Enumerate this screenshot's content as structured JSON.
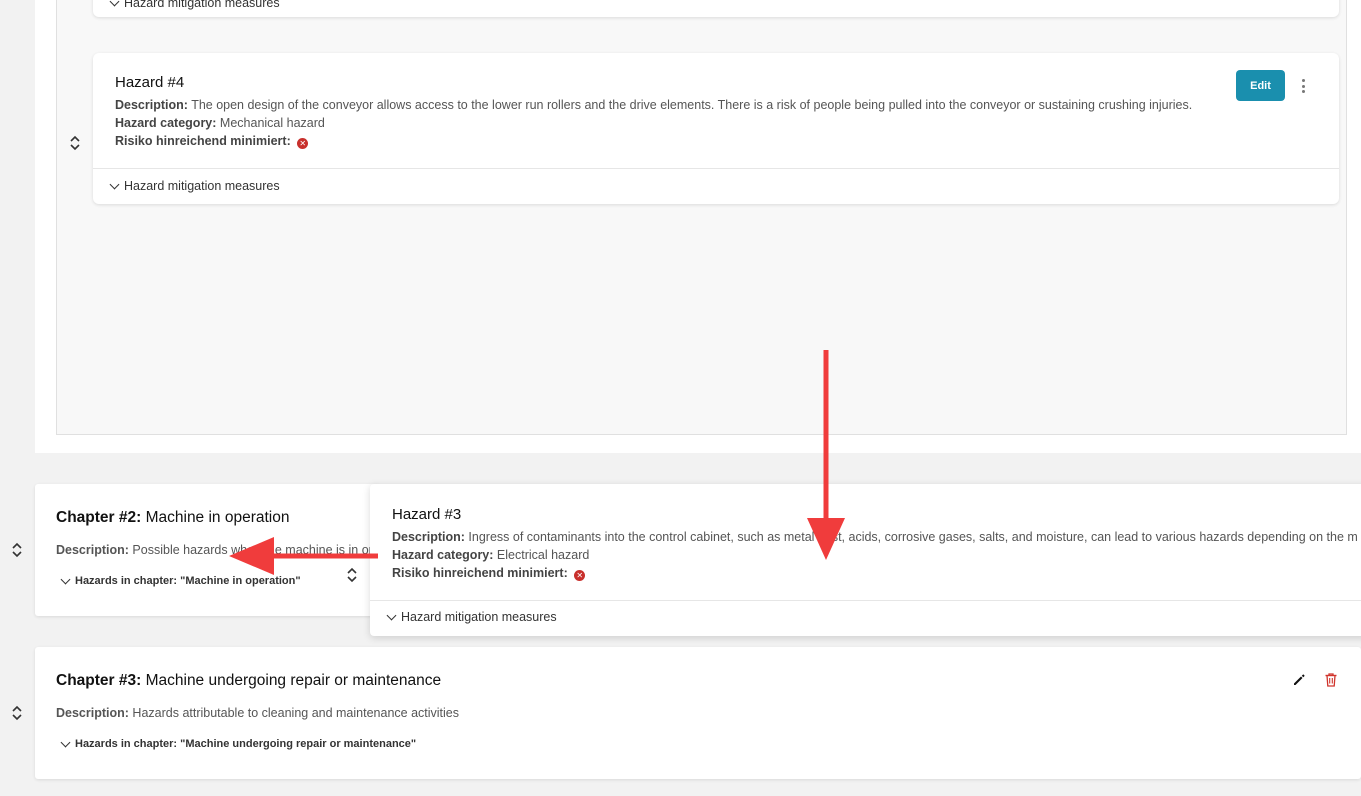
{
  "hazard_prev": {
    "toggle_label": "Hazard mitigation measures"
  },
  "hazard4": {
    "title": "Hazard #4",
    "description_label": "Description:",
    "description": "The open design of the conveyor allows access to the lower run rollers and the drive elements. There is a risk of people being pulled into the conveyor or sustaining crushing injuries.",
    "category_label": "Hazard category:",
    "category": "Mechanical hazard",
    "risk_label": "Risiko hinreichend minimiert:",
    "risk_icon": "x-circle-icon",
    "edit_label": "Edit",
    "toggle_label": "Hazard mitigation measures"
  },
  "chapter2": {
    "title_prefix": "Chapter #2:",
    "title": "Machine in operation",
    "description_label": "Description:",
    "description": "Possible hazards when the machine is in op",
    "toggle_label": "Hazards in chapter: \"Machine in operation\""
  },
  "hazard3": {
    "title": "Hazard #3",
    "description_label": "Description:",
    "description": "Ingress of contaminants into the control cabinet, such as metal dust, acids, corrosive gases, salts, and moisture, can lead to various hazards depending on the m",
    "category_label": "Hazard category:",
    "category": "Electrical hazard",
    "risk_label": "Risiko hinreichend minimiert:",
    "risk_icon": "x-circle-icon",
    "toggle_label": "Hazard mitigation measures"
  },
  "chapter3": {
    "title_prefix": "Chapter #3:",
    "title": "Machine undergoing repair or maintenance",
    "description_label": "Description:",
    "description": "Hazards attributable to cleaning and maintenance activities",
    "toggle_label": "Hazards in chapter: \"Machine undergoing repair or maintenance\""
  },
  "colors": {
    "accent": "#1a8fae",
    "danger": "#c8302c",
    "annotation_arrow": "#f03c3c"
  }
}
